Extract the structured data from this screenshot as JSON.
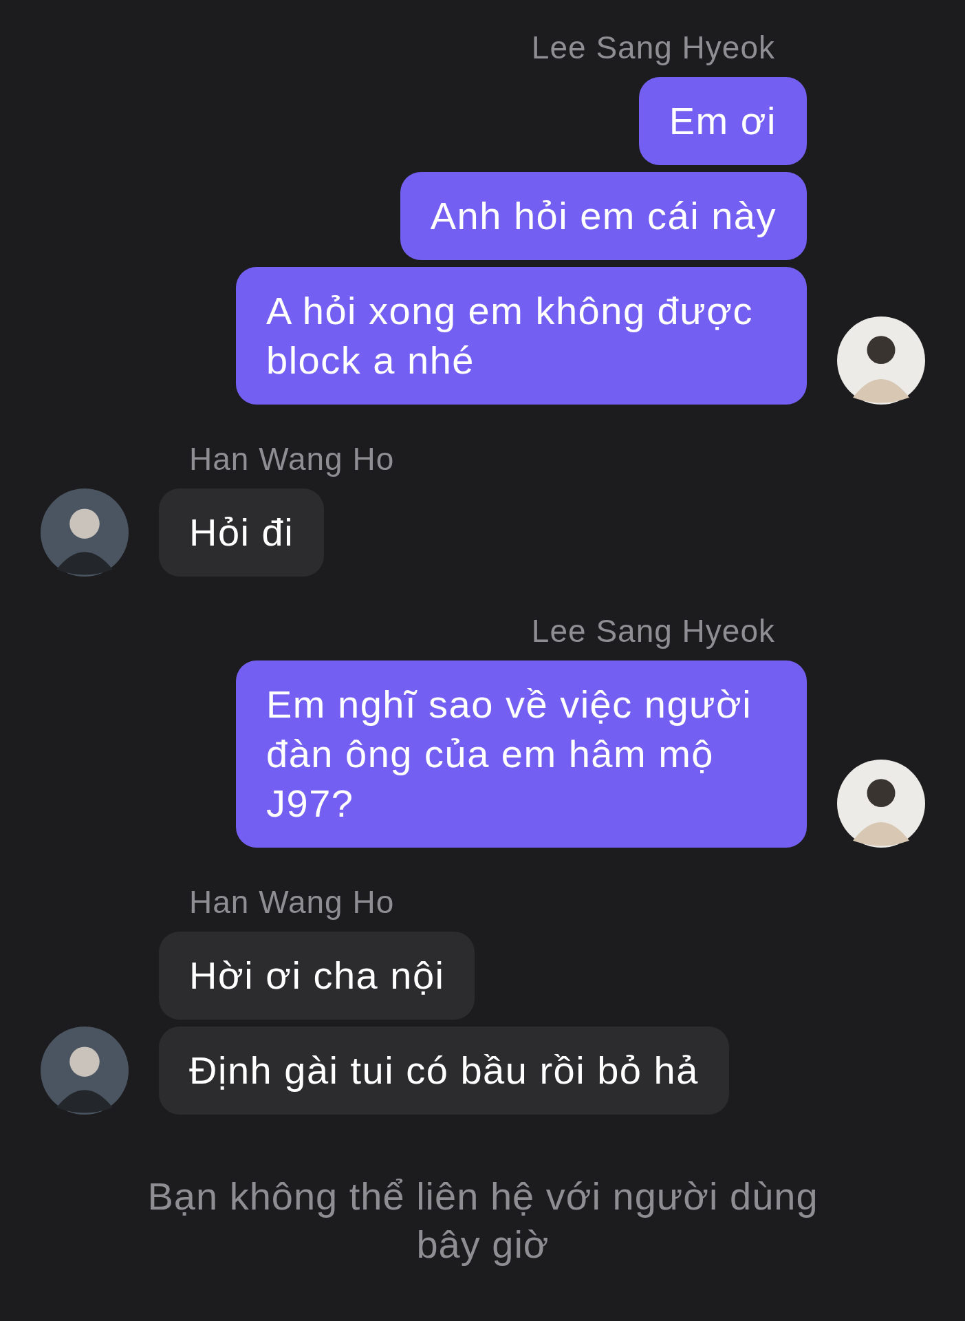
{
  "messages": [
    {
      "kind": "outgoing",
      "sender": "Lee Sang Hyeok",
      "texts": [
        "Em ơi",
        "Anh hỏi em cái này",
        "A hỏi xong em không được block a nhé"
      ]
    },
    {
      "kind": "incoming",
      "sender": "Han Wang Ho",
      "texts": [
        "Hỏi đi"
      ]
    },
    {
      "kind": "outgoing",
      "sender": "Lee Sang Hyeok",
      "texts": [
        "Em nghĩ sao về việc người đàn ông của em hâm mộ J97?"
      ]
    },
    {
      "kind": "incoming",
      "sender": "Han Wang Ho",
      "texts": [
        "Hời ơi cha nội",
        "Định gài tui có bầu rồi bỏ hả"
      ]
    }
  ],
  "notice": "Bạn không thể liên hệ với người dùng bây giờ"
}
